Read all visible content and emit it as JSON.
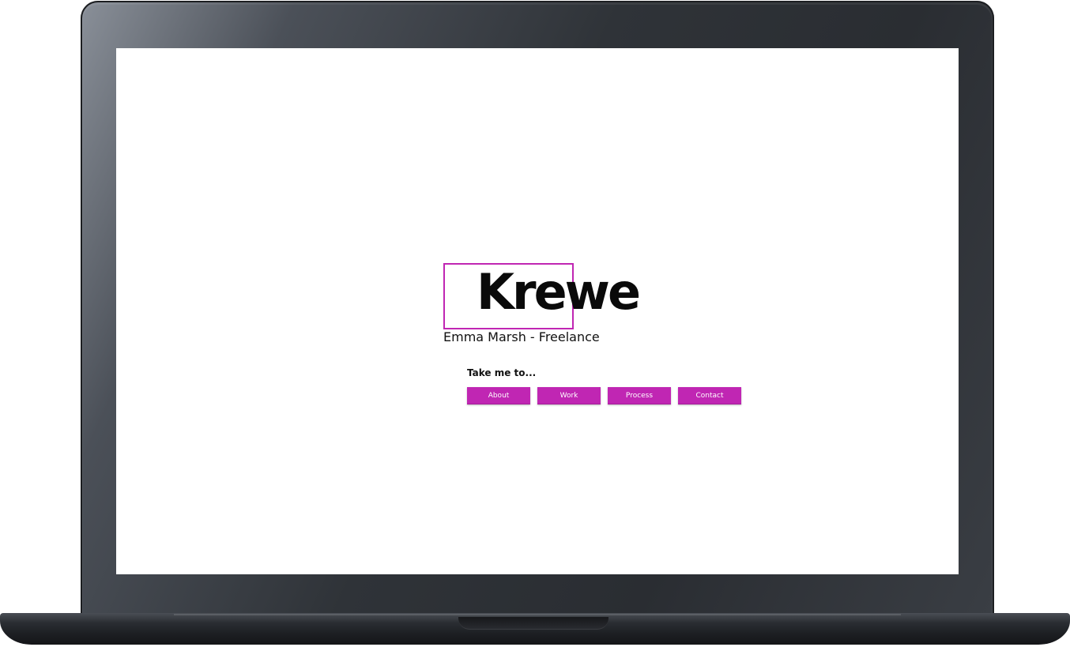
{
  "brand": {
    "logo_text": "Krewe",
    "accent_color": "#c026b3"
  },
  "hero": {
    "subtitle": "Emma Marsh - Freelance"
  },
  "nav": {
    "label": "Take me to...",
    "buttons": [
      {
        "label": "About"
      },
      {
        "label": "Work"
      },
      {
        "label": "Process"
      },
      {
        "label": "Contact"
      }
    ]
  }
}
